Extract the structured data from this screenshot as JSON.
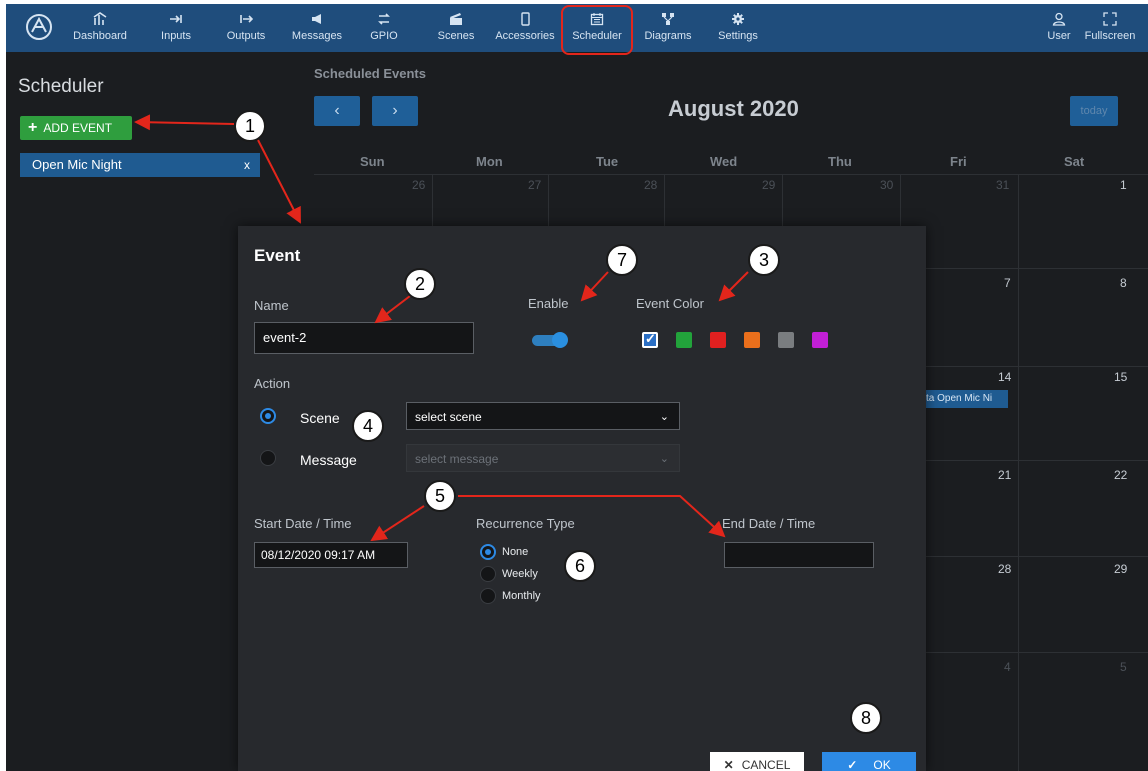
{
  "nav": {
    "items": [
      {
        "label": "Dashboard",
        "icon": "dashboard-icon"
      },
      {
        "label": "Inputs",
        "icon": "inputs-icon"
      },
      {
        "label": "Outputs",
        "icon": "outputs-icon"
      },
      {
        "label": "Messages",
        "icon": "megaphone-icon"
      },
      {
        "label": "GPIO",
        "icon": "gpio-icon"
      },
      {
        "label": "Scenes",
        "icon": "clapperboard-icon"
      },
      {
        "label": "Accessories",
        "icon": "device-icon"
      },
      {
        "label": "Scheduler",
        "icon": "calendar-icon"
      },
      {
        "label": "Diagrams",
        "icon": "diagram-icon"
      },
      {
        "label": "Settings",
        "icon": "gear-icon"
      }
    ],
    "user_label": "User",
    "fullscreen_label": "Fullscreen",
    "active": "Scheduler",
    "colors": {
      "bar": "#1f4d7c",
      "highlight": "#e3261b"
    }
  },
  "sidebar": {
    "title": "Scheduler",
    "add_event_label": "ADD EVENT",
    "events": [
      {
        "name": "Open Mic Night",
        "remove_label": "x"
      }
    ]
  },
  "calendar": {
    "section_title": "Scheduled Events",
    "prev_label": "‹",
    "next_label": "›",
    "month_label": "August 2020",
    "today_label": "today",
    "weekdays": [
      "Sun",
      "Mon",
      "Tue",
      "Wed",
      "Thu",
      "Fri",
      "Sat"
    ],
    "visible_days": {
      "row1": [
        "26",
        "27",
        "28",
        "29",
        "30",
        "31",
        "1"
      ],
      "row2": [
        "7",
        "8"
      ],
      "row3": [
        "14",
        "15"
      ],
      "row4": [
        "21",
        "22"
      ],
      "row5": [
        "28",
        "29"
      ],
      "row6": [
        "4",
        "5"
      ]
    },
    "event_label": "ta Open Mic Ni"
  },
  "modal": {
    "title": "Event",
    "name_label": "Name",
    "name_value": "event-2",
    "enable_label": "Enable",
    "enabled": true,
    "color_label": "Event Color",
    "colors": [
      "#2b6fc4",
      "#22a33b",
      "#e02020",
      "#ea6f1c",
      "#7a7d80",
      "#c21fd6"
    ],
    "selected_color": "#2b6fc4",
    "action_label": "Action",
    "actions": [
      {
        "label": "Scene",
        "selected": true,
        "select_value": "select scene"
      },
      {
        "label": "Message",
        "selected": false,
        "select_value": "select message"
      }
    ],
    "start_label": "Start Date / Time",
    "start_value": "08/12/2020 09:17 AM",
    "recurrence_label": "Recurrence Type",
    "recurrence_options": [
      {
        "label": "None",
        "selected": true
      },
      {
        "label": "Weekly",
        "selected": false
      },
      {
        "label": "Monthly",
        "selected": false
      }
    ],
    "end_label": "End Date / Time",
    "end_value": "",
    "cancel_label": "CANCEL",
    "ok_label": "OK"
  },
  "callouts": [
    "1",
    "2",
    "3",
    "4",
    "5",
    "6",
    "7",
    "8"
  ]
}
